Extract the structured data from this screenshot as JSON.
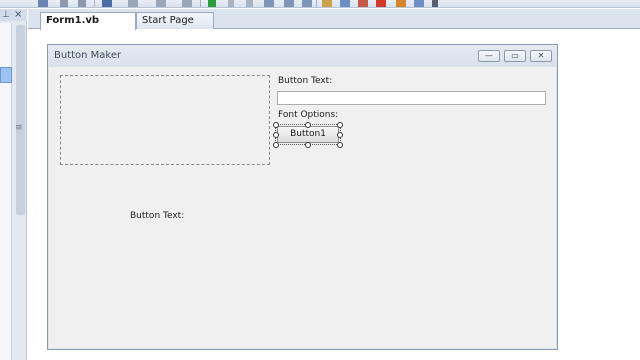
{
  "tabs": {
    "active": "Form1.vb [Design]*",
    "inactive": "Start Page"
  },
  "toolbox": {
    "pin": "⊥",
    "close": "×",
    "grip": "≡"
  },
  "form": {
    "title": "Button Maker",
    "minimize": "—",
    "maximize": "▭",
    "close": "✕",
    "label_button_text_top": "Button Text:",
    "label_font_options": "Font Options:",
    "label_button_text_bottom": "Button Text:",
    "textbox_value": "",
    "button1_label": "Button1"
  },
  "colors": {
    "accent_selection": "#9cc3ee",
    "form_background": "#f0f0f0",
    "toolbar_green": "#2a9d3a",
    "toolbar_red": "#d03a2a"
  },
  "toolbar_icons": [
    "save-icon",
    "align-left-icon",
    "align-center-icon",
    "undo-icon",
    "redo-icon",
    "nav-back-icon",
    "nav-forward-icon",
    "run-icon",
    "pause-icon",
    "stop-icon",
    "step-icon",
    "search-icon",
    "properties-icon",
    "toolbox-icon",
    "error-icon",
    "settings-icon",
    "more-icon"
  ]
}
